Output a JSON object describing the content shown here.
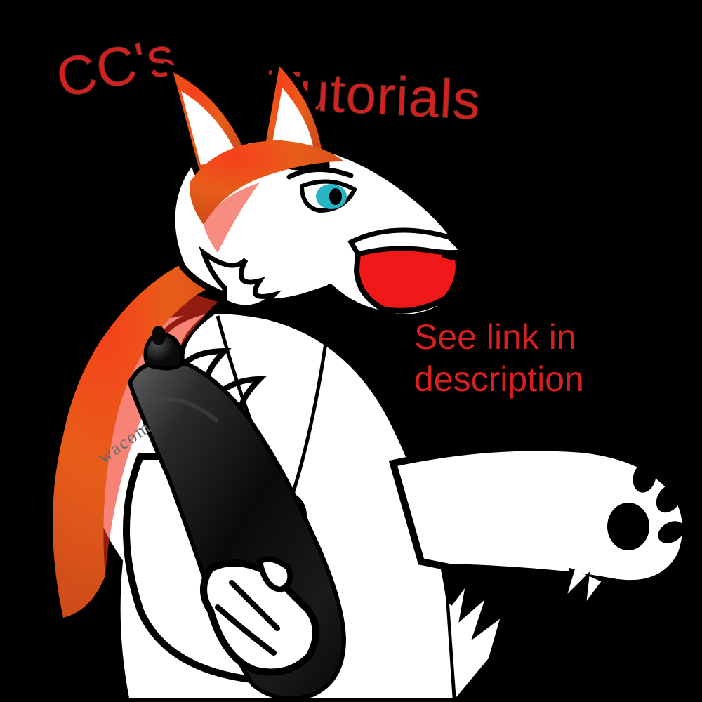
{
  "title": {
    "word1": "CC's",
    "word2": "Tutorials"
  },
  "subtitle": {
    "line1": "See link in",
    "line2": "description"
  },
  "illustration": {
    "subject": "anthropomorphic husky-fox character holding a drawing tablet stylus",
    "pen_brand": "wacom"
  },
  "colors": {
    "background": "#000000",
    "accent_red": "#d62020",
    "fur_orange_primary": "#e85d1a",
    "fur_orange_bright": "#f0301a",
    "fur_white": "#ffffff",
    "eye": "#29b4c4",
    "pendant": "#e8d82a",
    "pen_black": "#0e0e0e"
  }
}
